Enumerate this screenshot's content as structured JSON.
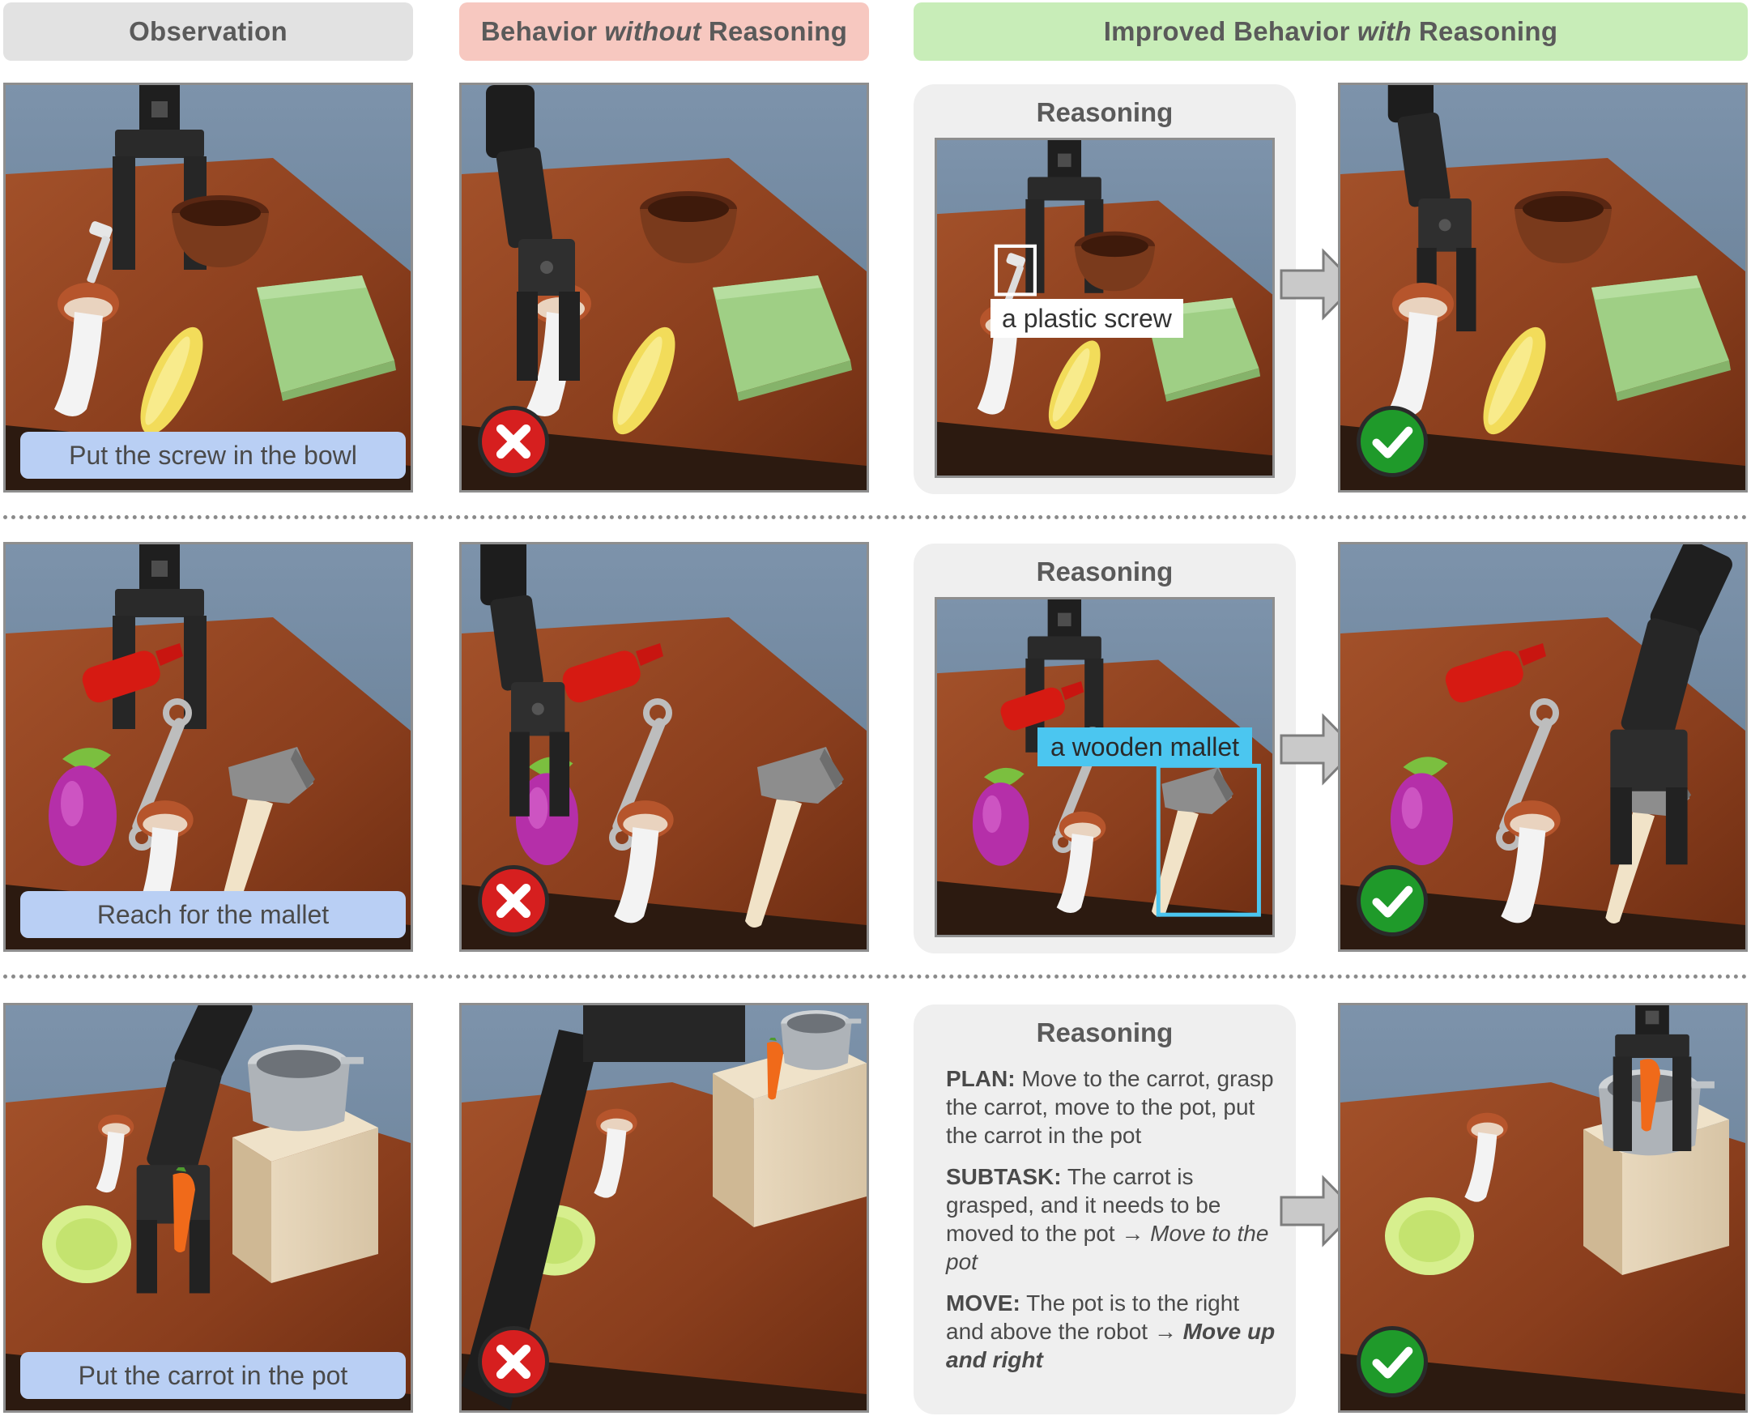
{
  "headers": {
    "observation": "Observation",
    "without_pre": "Behavior",
    "without_em": "without",
    "without_post": "Reasoning",
    "with_pre": "Improved Behavior",
    "with_em": "with",
    "with_post": "Reasoning"
  },
  "rows": [
    {
      "instruction": "Put the screw in the bowl",
      "reasoning_title": "Reasoning",
      "reasoning_label": "a plastic screw"
    },
    {
      "instruction": "Reach for the mallet",
      "reasoning_title": "Reasoning",
      "reasoning_label": "a wooden mallet"
    },
    {
      "instruction": "Put the carrot in the pot",
      "reasoning_title": "Reasoning",
      "plan_label": "PLAN:",
      "plan_text": "Move to the carrot, grasp the carrot, move to the pot, put the carrot in the pot",
      "subtask_label": "SUBTASK:",
      "subtask_text": "The carrot is grasped, and it needs to be moved to the pot →",
      "subtask_action": "Move to the pot",
      "move_label": "MOVE:",
      "move_text": "The pot is to the right and above the robot →",
      "move_action": "Move up and right"
    }
  ],
  "colors": {
    "observation_header": "#e2e2e2",
    "without_header": "#f7c8c0",
    "with_header": "#c8edb8",
    "caption": "#b9cff4",
    "fail": "#d61f1f",
    "success": "#1f9a2a",
    "highlight_blue": "#4bc6f0"
  }
}
